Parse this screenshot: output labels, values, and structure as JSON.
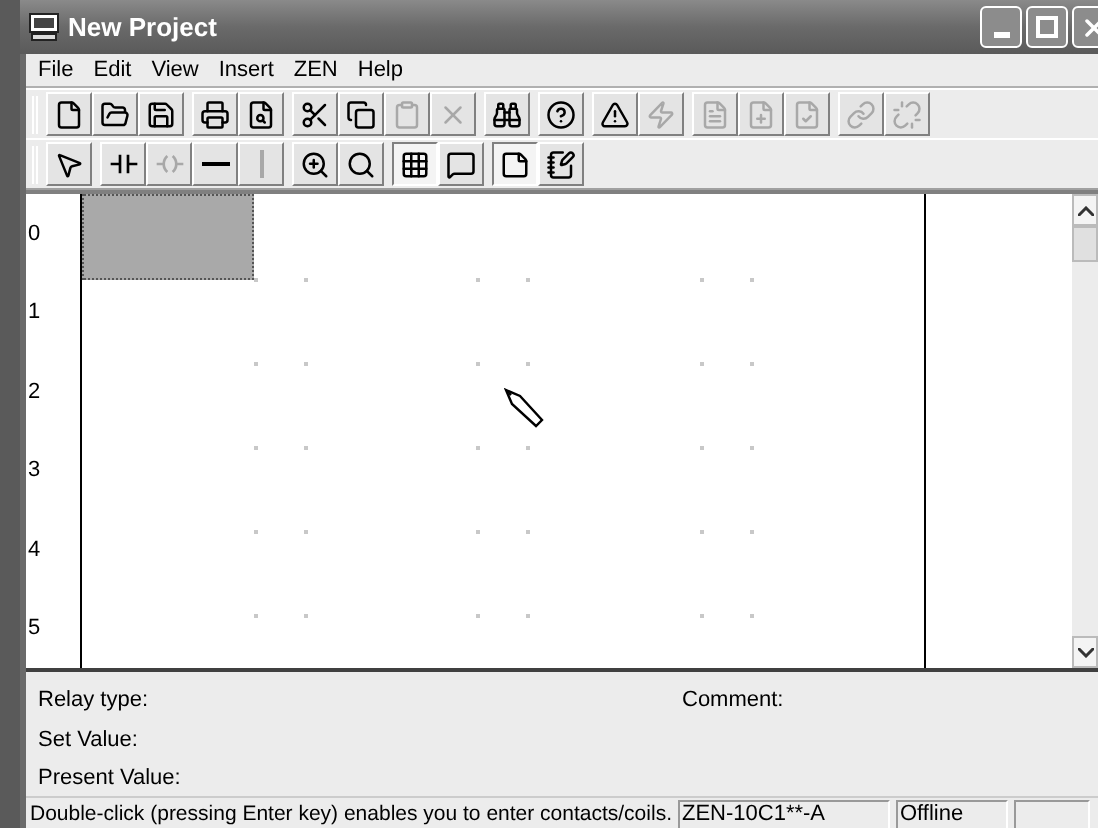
{
  "window": {
    "title": "New Project"
  },
  "menu": [
    "File",
    "Edit",
    "View",
    "Insert",
    "ZEN",
    "Help"
  ],
  "toolbars": [
    {
      "groups": [
        {
          "buttons": [
            {
              "kind": "new",
              "disabled": false,
              "pressed": false
            },
            {
              "kind": "open",
              "disabled": false,
              "pressed": false
            },
            {
              "kind": "save",
              "disabled": false,
              "pressed": false
            }
          ]
        },
        {
          "buttons": [
            {
              "kind": "print",
              "disabled": false,
              "pressed": false
            },
            {
              "kind": "preview",
              "disabled": false,
              "pressed": false
            }
          ]
        },
        {
          "buttons": [
            {
              "kind": "cut",
              "disabled": false,
              "pressed": false
            },
            {
              "kind": "copy",
              "disabled": false,
              "pressed": false
            },
            {
              "kind": "paste",
              "disabled": true,
              "pressed": false
            },
            {
              "kind": "delete",
              "disabled": true,
              "pressed": false
            }
          ]
        },
        {
          "buttons": [
            {
              "kind": "find",
              "disabled": false,
              "pressed": false
            }
          ]
        },
        {
          "buttons": [
            {
              "kind": "help",
              "disabled": false,
              "pressed": false
            }
          ]
        },
        {
          "buttons": [
            {
              "kind": "warning",
              "disabled": false,
              "pressed": false
            },
            {
              "kind": "transfer",
              "disabled": true,
              "pressed": false
            }
          ]
        },
        {
          "buttons": [
            {
              "kind": "doc",
              "disabled": true,
              "pressed": false
            },
            {
              "kind": "doc-add",
              "disabled": true,
              "pressed": false
            },
            {
              "kind": "doc-check",
              "disabled": true,
              "pressed": false
            }
          ]
        },
        {
          "buttons": [
            {
              "kind": "link",
              "disabled": true,
              "pressed": false
            },
            {
              "kind": "unlink",
              "disabled": true,
              "pressed": false
            }
          ]
        }
      ]
    },
    {
      "groups": [
        {
          "buttons": [
            {
              "kind": "pointer",
              "disabled": false,
              "pressed": false
            }
          ]
        },
        {
          "buttons": [
            {
              "kind": "contact",
              "disabled": false,
              "pressed": false
            },
            {
              "kind": "coil",
              "disabled": true,
              "pressed": false
            },
            {
              "kind": "hline",
              "disabled": false,
              "pressed": false
            },
            {
              "kind": "vline",
              "disabled": true,
              "pressed": false
            }
          ]
        },
        {
          "buttons": [
            {
              "kind": "zoom-small",
              "disabled": false,
              "pressed": false
            },
            {
              "kind": "zoom",
              "disabled": false,
              "pressed": false
            }
          ]
        },
        {
          "buttons": [
            {
              "kind": "grid",
              "disabled": false,
              "pressed": true
            },
            {
              "kind": "comment",
              "disabled": false,
              "pressed": false
            }
          ]
        },
        {
          "buttons": [
            {
              "kind": "note",
              "disabled": false,
              "pressed": true
            },
            {
              "kind": "note-edit",
              "disabled": false,
              "pressed": false
            }
          ]
        }
      ]
    }
  ],
  "ladder": {
    "rows": [
      "0",
      "1",
      "2",
      "3",
      "4",
      "5"
    ]
  },
  "info": {
    "relay_type": "Relay type:",
    "set_value": "Set Value:",
    "present_value": "Present Value:",
    "comment": "Comment:"
  },
  "status_bar": {
    "message": "Double-click (pressing Enter key) enables you to enter contacts/coils.",
    "model": "ZEN-10C1**-A",
    "mode": "Offline"
  }
}
